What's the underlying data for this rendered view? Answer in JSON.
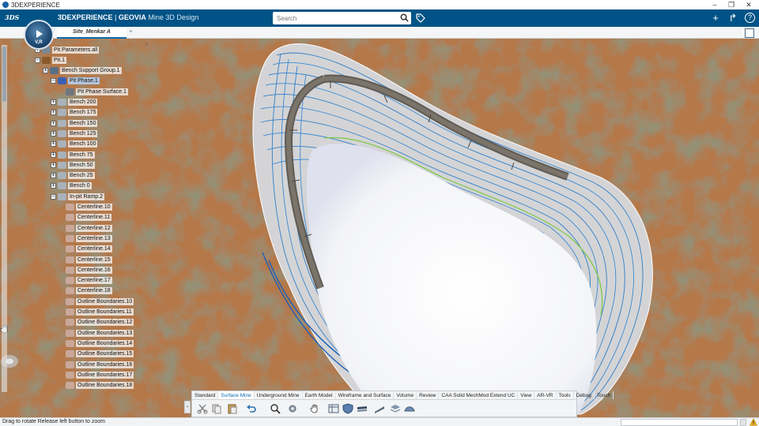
{
  "window": {
    "title": "3DEXPERIENCE",
    "min": "–",
    "restore": "❐",
    "close": "✕"
  },
  "header": {
    "logo": "3DS",
    "compass_label": "V,R",
    "brand_bold": "3DEXPERIENCE",
    "brand_sep": " | ",
    "brand_geovia": "GEOVIA",
    "app_name": "Mine 3D Design",
    "search_placeholder": "Search",
    "add": "+",
    "share": "↱",
    "help": "?"
  },
  "tabs": {
    "active": "Site_Menkar A",
    "add": "+"
  },
  "tree": {
    "collapse": "‹",
    "nodes": [
      {
        "label": "Pit Parameters.all",
        "exp": "+",
        "color": "#7a8794"
      },
      {
        "label": "Pit.1",
        "exp": "−",
        "color": "#8b5a2b"
      },
      {
        "label": "Bench Support Group.1",
        "exp": "+",
        "color": "#5a6e85"
      },
      {
        "label": "Pit Phase.1",
        "exp": "−",
        "color": "#3b5fb5",
        "selected": true
      },
      {
        "label": "Pit Phase Surface.1",
        "exp": "",
        "color": "#707780"
      },
      {
        "label": "Bench 200",
        "exp": "+",
        "color": "#a9b2bb"
      },
      {
        "label": "Bench 175",
        "exp": "+",
        "color": "#a9b2bb"
      },
      {
        "label": "Bench 150",
        "exp": "+",
        "color": "#a9b2bb"
      },
      {
        "label": "Bench 125",
        "exp": "+",
        "color": "#a9b2bb"
      },
      {
        "label": "Bench 100",
        "exp": "+",
        "color": "#a9b2bb"
      },
      {
        "label": "Bench 75",
        "exp": "+",
        "color": "#a9b2bb"
      },
      {
        "label": "Bench 50",
        "exp": "+",
        "color": "#a9b2bb"
      },
      {
        "label": "Bench 25",
        "exp": "+",
        "color": "#a9b2bb"
      },
      {
        "label": "Bench 0",
        "exp": "+",
        "color": "#a9b2bb"
      },
      {
        "label": "In-pit Ramp.2",
        "exp": "−",
        "color": "#a9b2bb"
      },
      {
        "label": "Centerline.10",
        "exp": "",
        "color": "#c9a89a"
      },
      {
        "label": "Centerline.11",
        "exp": "",
        "color": "#c9a89a"
      },
      {
        "label": "Centerline.12",
        "exp": "",
        "color": "#c9a89a"
      },
      {
        "label": "Centerline.13",
        "exp": "",
        "color": "#c9a89a"
      },
      {
        "label": "Centerline.14",
        "exp": "",
        "color": "#c9a89a"
      },
      {
        "label": "Centerline.15",
        "exp": "",
        "color": "#c9a89a"
      },
      {
        "label": "Centerline.16",
        "exp": "",
        "color": "#c9a89a"
      },
      {
        "label": "Centerline.17",
        "exp": "",
        "color": "#c9a89a"
      },
      {
        "label": "Centerline.18",
        "exp": "",
        "color": "#c9a89a"
      },
      {
        "label": "Outline Boundaries.10",
        "exp": "",
        "color": "#c9a89a"
      },
      {
        "label": "Outline Boundaries.11",
        "exp": "",
        "color": "#c9a89a"
      },
      {
        "label": "Outline Boundaries.12",
        "exp": "",
        "color": "#c9a89a"
      },
      {
        "label": "Outline Boundaries.13",
        "exp": "",
        "color": "#c9a89a"
      },
      {
        "label": "Outline Boundaries.14",
        "exp": "",
        "color": "#c9a89a"
      },
      {
        "label": "Outline Boundaries.15",
        "exp": "",
        "color": "#c9a89a"
      },
      {
        "label": "Outline Boundaries.16",
        "exp": "",
        "color": "#c9a89a"
      },
      {
        "label": "Outline Boundaries.17",
        "exp": "",
        "color": "#c9a89a"
      },
      {
        "label": "Outline Boundaries.18",
        "exp": "",
        "color": "#c9a89a"
      }
    ]
  },
  "commandbar": {
    "expand": "›",
    "tabs": [
      "Standard",
      "Surface Mine",
      "Underground Mine",
      "Earth Model",
      "Wireframe and Surface",
      "Volume",
      "Review",
      "CAA Solid MechMod Extend UC",
      "View",
      "AR-VR",
      "Tools",
      "Debug",
      "Touch"
    ],
    "active_tab": "Surface Mine",
    "icons": [
      "cut-icon",
      "copy-icon",
      "paste-icon",
      "undo-icon",
      "zoom-icon",
      "settings-icon",
      "hand-icon",
      "table-icon",
      "shield-icon",
      "bench-icon",
      "ramp-icon",
      "layers-icon",
      "surface-icon"
    ]
  },
  "status": {
    "text": "Drag to rotate  Release left button to zoom"
  },
  "colors": {
    "header": "#005386",
    "accent": "#0f6cb0",
    "terrain": "#b07a4a",
    "contour": "#2e7fc9",
    "toe": "#7ac943",
    "ramp": "#6b655d"
  }
}
